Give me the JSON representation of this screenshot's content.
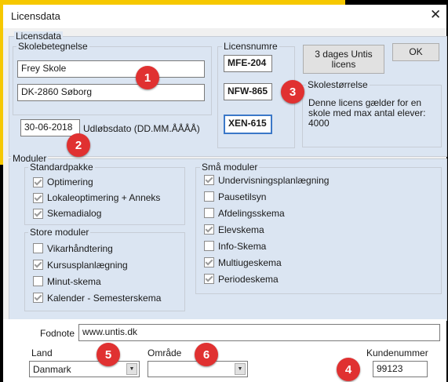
{
  "window": {
    "title": "Licensdata",
    "close_symbol": "✕"
  },
  "licensdata": {
    "label": "Licensdata",
    "skolebetegnelse": {
      "label": "Skolebetegnelse",
      "line1": "Frey Skole",
      "line2": "DK-2860 Søborg"
    },
    "expiry": {
      "value": "30-06-2018",
      "label": "Udløbsdato (DD.MM.ÅÅÅÅ)"
    },
    "licensnumre": {
      "label": "Licensnumre",
      "values": [
        "MFE-204",
        "NFW-865",
        "XEN-615"
      ]
    },
    "trial_button": "3 dages Untis licens",
    "ok_button": "OK",
    "skolestorrelse": {
      "label": "Skolestørrelse",
      "text": "Denne licens gælder for en skole med max antal elever: 4000"
    }
  },
  "moduler": {
    "label": "Moduler",
    "standardpakke": {
      "label": "Standardpakke",
      "items": [
        {
          "label": "Optimering",
          "checked": true
        },
        {
          "label": "Lokaleoptimering + Anneks",
          "checked": true
        },
        {
          "label": "Skemadialog",
          "checked": true
        }
      ]
    },
    "store": {
      "label": "Store moduler",
      "items": [
        {
          "label": "Vikarhåndtering",
          "checked": false
        },
        {
          "label": "Kursusplanlægning",
          "checked": true
        },
        {
          "label": "Minut-skema",
          "checked": false
        },
        {
          "label": "Kalender - Semesterskema",
          "checked": true
        }
      ]
    },
    "sma": {
      "label": "Små moduler",
      "items": [
        {
          "label": "Undervisningsplanlægning",
          "checked": true
        },
        {
          "label": "Pausetilsyn",
          "checked": false
        },
        {
          "label": "Afdelingsskema",
          "checked": false
        },
        {
          "label": "Elevskema",
          "checked": true
        },
        {
          "label": "Info-Skema",
          "checked": false
        },
        {
          "label": "Multiugeskema",
          "checked": true
        },
        {
          "label": "Periodeskema",
          "checked": true
        }
      ]
    }
  },
  "footer": {
    "fodnote": {
      "label": "Fodnote",
      "value": "www.untis.dk"
    },
    "land": {
      "label": "Land",
      "value": "Danmark"
    },
    "omrade": {
      "label": "Område",
      "value": ""
    },
    "kundenummer": {
      "label": "Kundenummer",
      "value": "99123"
    },
    "dropdown_glyph": "▼"
  },
  "markers": [
    "1",
    "2",
    "3",
    "4",
    "5",
    "6"
  ],
  "colors": {
    "accent_yellow": "#f6c800",
    "marker_red": "#e03131",
    "group_bg": "#dbe5f2"
  }
}
